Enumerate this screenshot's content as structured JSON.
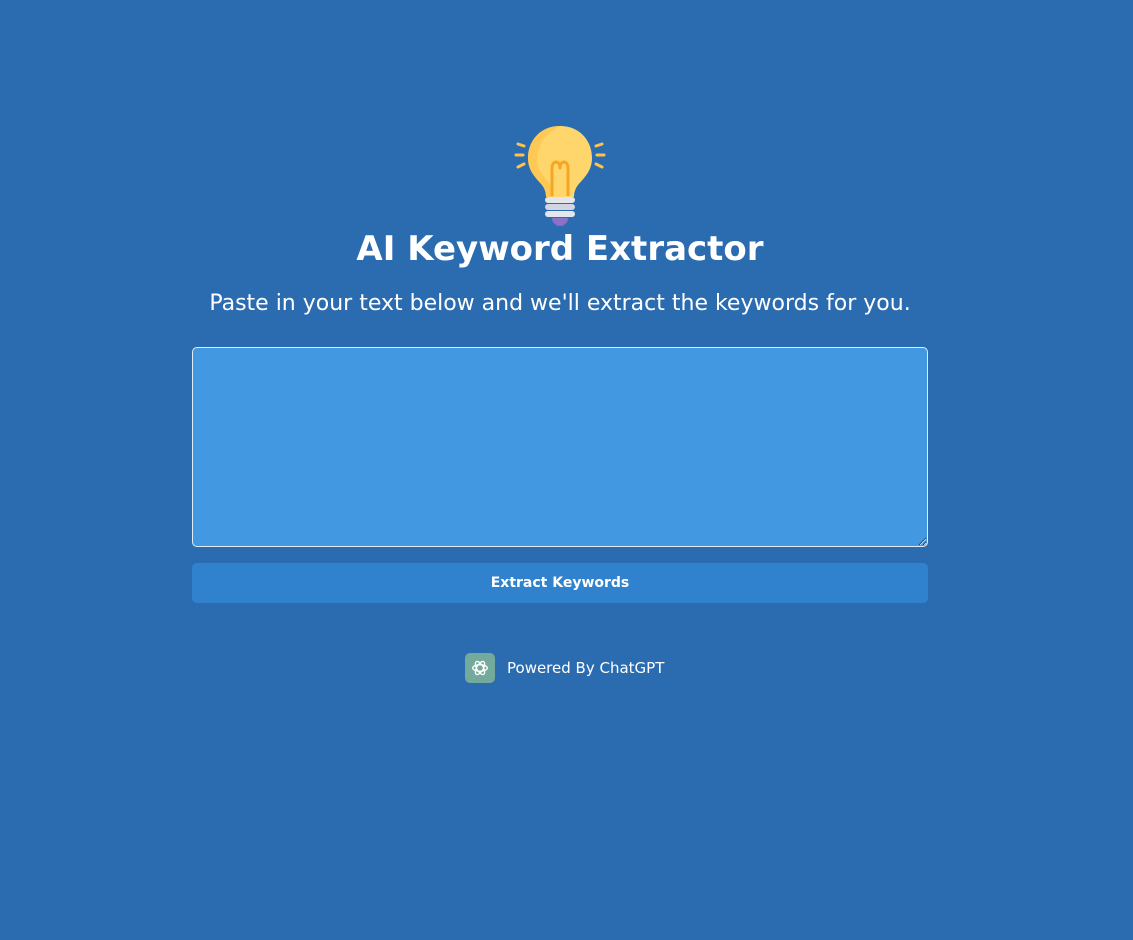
{
  "header": {
    "icon": "lightbulb-icon",
    "title": "AI Keyword Extractor",
    "subtitle": "Paste in your text below and we'll extract the keywords for you."
  },
  "form": {
    "text_value": "",
    "text_placeholder": "",
    "submit_label": "Extract Keywords"
  },
  "footer": {
    "icon": "chatgpt-logo-icon",
    "text": "Powered By ChatGPT"
  },
  "colors": {
    "background": "#2b6cb0",
    "textarea_bg": "#4299e1",
    "button_bg": "#3182ce",
    "bulb_yellow": "#ffd66b",
    "chatgpt_green": "#74aa9c"
  }
}
